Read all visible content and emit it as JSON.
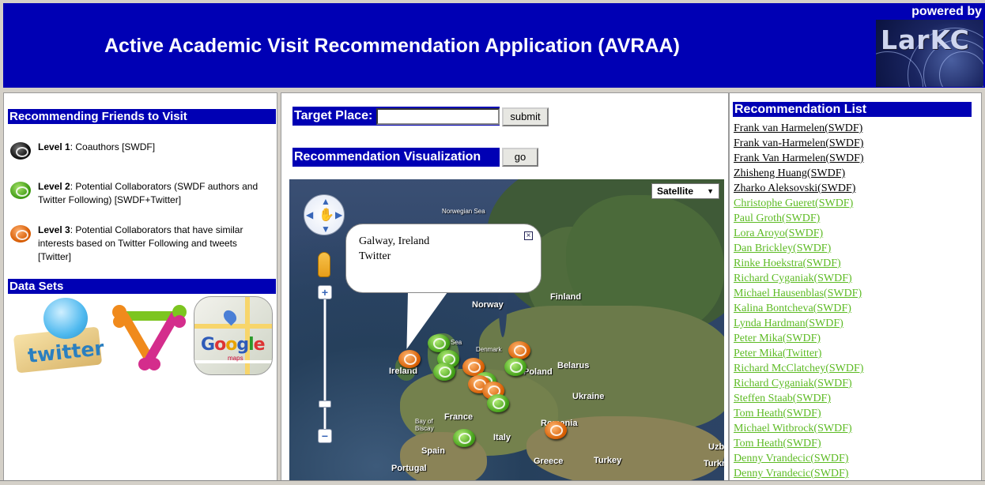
{
  "header": {
    "title": "Active Academic Visit Recommendation Application (AVRAA)",
    "powered_by": "powered by",
    "logo_text": "LarKC"
  },
  "left": {
    "section_title": "Recommending Friends to Visit",
    "levels": [
      {
        "name": "Level 1",
        "description": ": Coauthors [SWDF]",
        "color": "black"
      },
      {
        "name": "Level 2",
        "description": ": Potential Collaborators (SWDF authors and Twitter Following) [SWDF+Twitter]",
        "color": "green"
      },
      {
        "name": "Level 3",
        "description": ": Potential Collaborators that have similar interests based on Twitter Following and tweets [Twitter]",
        "color": "orange"
      }
    ],
    "datasets_title": "Data Sets",
    "datasets": [
      {
        "name": "twitter",
        "label": "twitter"
      },
      {
        "name": "foaf",
        "label": ""
      },
      {
        "name": "google-maps",
        "label": "Google",
        "sub": "maps"
      }
    ]
  },
  "center": {
    "target_place_label": "Target Place:",
    "target_place_value": "",
    "submit_label": "submit",
    "visualization_label": "Recommendation Visualization",
    "go_label": "go",
    "map": {
      "map_type": "Satellite",
      "popup_lines": [
        "Galway, Ireland",
        "Twitter"
      ],
      "labels": [
        "Norwegian Sea",
        "Norway",
        "Finland",
        "Sea",
        "Denmark",
        "Ireland",
        "Belarus",
        "Poland",
        "Ukraine",
        "France",
        "Bay of Biscay",
        "Italy",
        "Romania",
        "Spain",
        "Portugal",
        "Greece",
        "Turkey",
        "Uzb",
        "Turkmeni"
      ]
    }
  },
  "right": {
    "title": "Recommendation List",
    "items": [
      {
        "label": "Frank van Harmelen(SWDF)",
        "level": "black"
      },
      {
        "label": "Frank van-Harmelen(SWDF)",
        "level": "black"
      },
      {
        "label": "Frank Van Harmelen(SWDF)",
        "level": "black"
      },
      {
        "label": "Zhisheng Huang(SWDF)",
        "level": "black"
      },
      {
        "label": "Zharko Aleksovski(SWDF)",
        "level": "black"
      },
      {
        "label": "Christophe Gueret(SWDF)",
        "level": "green"
      },
      {
        "label": "Paul Groth(SWDF)",
        "level": "green"
      },
      {
        "label": "Lora Aroyo(SWDF)",
        "level": "green"
      },
      {
        "label": "Dan Brickley(SWDF)",
        "level": "green"
      },
      {
        "label": "Rinke Hoekstra(SWDF)",
        "level": "green"
      },
      {
        "label": "Richard Cyganiak(SWDF)",
        "level": "green"
      },
      {
        "label": "Michael Hausenblas(SWDF)",
        "level": "green"
      },
      {
        "label": "Kalina Bontcheva(SWDF)",
        "level": "green"
      },
      {
        "label": "Lynda Hardman(SWDF)",
        "level": "green"
      },
      {
        "label": "Peter Mika(SWDF)",
        "level": "green"
      },
      {
        "label": "Peter Mika(Twitter)",
        "level": "green"
      },
      {
        "label": "Richard McClatchey(SWDF)",
        "level": "green"
      },
      {
        "label": "Richard Cyganiak(SWDF)",
        "level": "green"
      },
      {
        "label": "Steffen Staab(SWDF)",
        "level": "green"
      },
      {
        "label": "Tom Heath(SWDF)",
        "level": "green"
      },
      {
        "label": "Michael Witbrock(SWDF)",
        "level": "green"
      },
      {
        "label": "Tom Heath(SWDF)",
        "level": "green"
      },
      {
        "label": "Denny Vrandecic(SWDF)",
        "level": "green"
      },
      {
        "label": "Denny Vrandecic(SWDF)",
        "level": "green"
      }
    ]
  },
  "colors": {
    "header_bg": "#0000b4",
    "level1": "#000000",
    "level2": "#5dbb24",
    "level3": "#d65a00"
  }
}
